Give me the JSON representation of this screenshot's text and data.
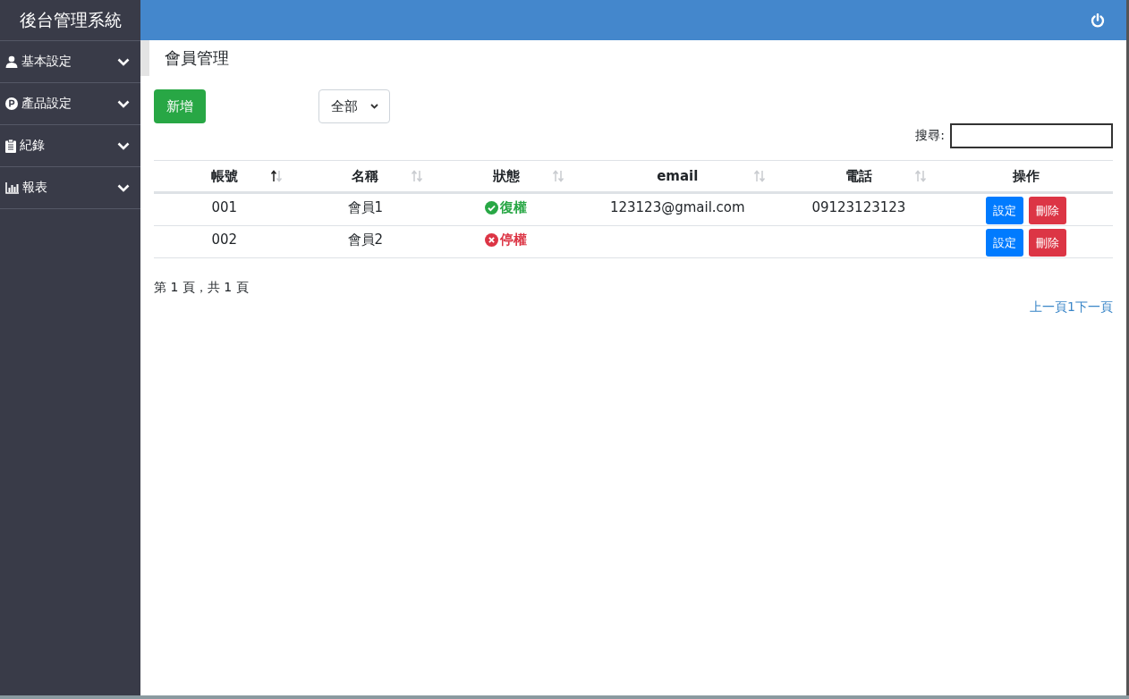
{
  "sidebar": {
    "title": "後台管理系統",
    "items": [
      {
        "label": "基本設定",
        "expanded": false
      },
      {
        "label": "產品設定",
        "expanded": false
      },
      {
        "label": "紀錄",
        "expanded": false
      },
      {
        "label": "報表",
        "expanded": false
      }
    ]
  },
  "page_title": "會員管理",
  "toolbar": {
    "add_button": "新增",
    "filter": {
      "value": "全部"
    }
  },
  "search": {
    "label": "搜尋:"
  },
  "table": {
    "columns": [
      {
        "label": "帳號",
        "kind": "sortable",
        "sorted": true
      },
      {
        "label": "名稱",
        "kind": "sortable",
        "sorted": false
      },
      {
        "label": "狀態",
        "kind": "sortable",
        "sorted": false
      },
      {
        "label": "email",
        "kind": "sortable",
        "sorted": false
      },
      {
        "label": "電話",
        "kind": "sortable",
        "sorted": false
      },
      {
        "label": "操作",
        "kind": "plain"
      }
    ],
    "rows": [
      {
        "account": "001",
        "name": "會員1",
        "status": {
          "kind": "active",
          "label": "復權"
        },
        "email": "123123@gmail.com",
        "phone": "09123123123",
        "actions": [
          "設定",
          "刪除"
        ]
      },
      {
        "account": "002",
        "name": "會員2",
        "status": {
          "kind": "suspended",
          "label": "停權"
        },
        "email": "",
        "phone": "",
        "actions": [
          "設定",
          "刪除"
        ]
      }
    ]
  },
  "page_info": "第 1 頁，共 1 頁",
  "pagination": [
    "上一頁",
    "1",
    "下一頁"
  ]
}
